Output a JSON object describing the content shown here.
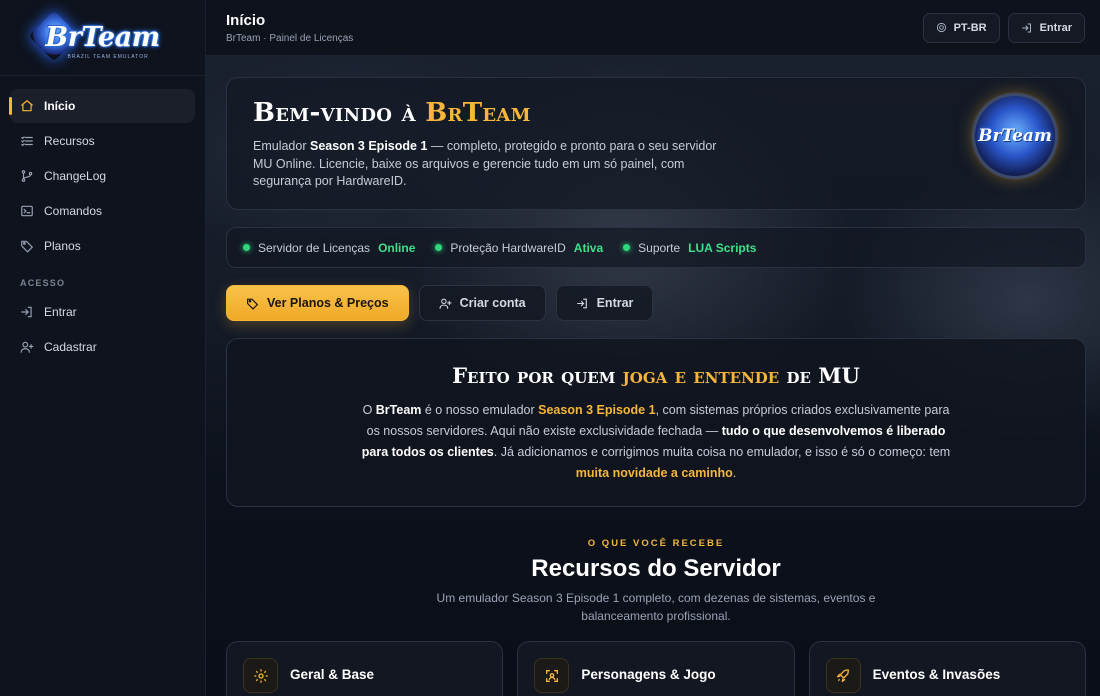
{
  "brand": {
    "logo_text": "BrTeam",
    "logo_sub": "BRAZIL TEAM EMULATOR"
  },
  "sidebar": {
    "items": [
      {
        "label": "Início",
        "icon": "home-icon",
        "active": true
      },
      {
        "label": "Recursos",
        "icon": "list-icon"
      },
      {
        "label": "ChangeLog",
        "icon": "git-branch-icon"
      },
      {
        "label": "Comandos",
        "icon": "terminal-icon"
      },
      {
        "label": "Planos",
        "icon": "tag-icon"
      }
    ],
    "section_label": "ACESSO",
    "access_items": [
      {
        "label": "Entrar",
        "icon": "login-icon"
      },
      {
        "label": "Cadastrar",
        "icon": "user-plus-icon"
      }
    ]
  },
  "header": {
    "title": "Início",
    "breadcrumb": "BrTeam · Painel de Licenças",
    "lang_label": "PT-BR",
    "login_label": "Entrar"
  },
  "welcome": {
    "title_prefix": "Bem-vindo à",
    "title_accent": "BrTeam",
    "text_1": "Emulador ",
    "text_bold": "Season 3 Episode 1",
    "text_2": " — completo, protegido e pronto para o seu servidor MU Online. Licencie, baixe os arquivos e gerencie tudo em um só painel, com segurança por HardwareID.",
    "emblem_text": "BrTeam"
  },
  "status": [
    {
      "label": "Servidor de Licenças",
      "value": "Online"
    },
    {
      "label": "Proteção HardwareID",
      "value": "Ativa"
    },
    {
      "label": "Suporte",
      "value": "LUA Scripts"
    }
  ],
  "actions": {
    "plans": "Ver Planos & Preços",
    "create": "Criar conta",
    "login": "Entrar"
  },
  "made": {
    "title_1": "Feito por quem",
    "title_accent": "joga e entende",
    "title_2": "de MU",
    "p_1": "O ",
    "p_brand": "BrTeam",
    "p_2": " é o nosso emulador ",
    "p_gold_1": "Season 3 Episode 1",
    "p_3": ", com sistemas próprios criados exclusivamente para os nossos servidores. Aqui não existe exclusividade fechada — ",
    "p_bold": "tudo o que desenvolvemos é liberado para todos os clientes",
    "p_4": ". Já adicionamos e corrigimos muita coisa no emulador, e isso é só o começo: tem ",
    "p_gold_2": "muita novidade a caminho",
    "p_5": "."
  },
  "features": {
    "eyebrow": "O QUE VOCÊ RECEBE",
    "title": "Recursos do Servidor",
    "subtitle": "Um emulador Season 3 Episode 1 completo, com dezenas de sistemas, eventos e balanceamento profissional.",
    "cards": [
      {
        "title": "Geral & Base",
        "icon": "gear-icon"
      },
      {
        "title": "Personagens & Jogo",
        "icon": "scan-icon"
      },
      {
        "title": "Eventos & Invasões",
        "icon": "rocket-icon"
      }
    ]
  },
  "colors": {
    "accent": "#f5b63a",
    "status_ok": "#3fe08a",
    "bg": "#0b0f19"
  }
}
